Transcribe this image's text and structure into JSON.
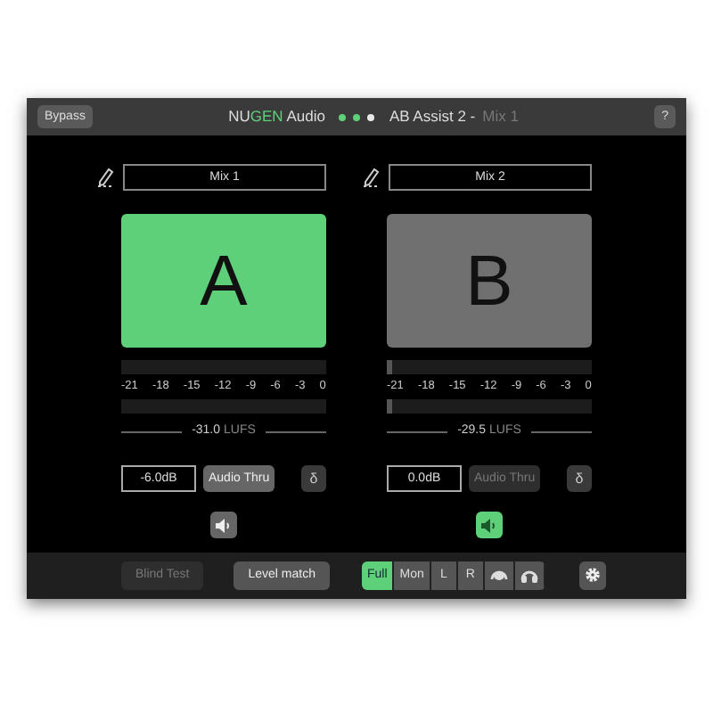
{
  "header": {
    "bypass": "Bypass",
    "brand": {
      "prefix": "NU",
      "highlight": "GEN",
      "suffix": "Audio"
    },
    "dots": [
      {
        "color": "#5fd07a"
      },
      {
        "color": "#5fd07a"
      },
      {
        "color": "#e8e8e8"
      }
    ],
    "product": "AB Assist 2 -",
    "mix": "Mix 1",
    "help": "?"
  },
  "channels": [
    {
      "label": "Mix 1",
      "letter": "A",
      "selected": true,
      "meters": [
        {
          "level": 0
        },
        {
          "level": 0
        }
      ],
      "scale": [
        "-21",
        "-18",
        "-15",
        "-12",
        "-9",
        "-6",
        "-3",
        "0"
      ],
      "lufs_value": "-31.0",
      "lufs_unit": "LUFS",
      "gain": "-6.0dB",
      "audio_thru": {
        "label": "Audio Thru",
        "on": true
      },
      "delta": "δ",
      "speaker_on": false
    },
    {
      "label": "Mix 2",
      "letter": "B",
      "selected": false,
      "meters": [
        {
          "level": 0.03
        },
        {
          "level": 0.03
        }
      ],
      "scale": [
        "-21",
        "-18",
        "-15",
        "-12",
        "-9",
        "-6",
        "-3",
        "0"
      ],
      "lufs_value": "-29.5",
      "lufs_unit": "LUFS",
      "gain": "0.0dB",
      "audio_thru": {
        "label": "Audio Thru",
        "on": false
      },
      "delta": "δ",
      "speaker_on": true
    }
  ],
  "footer": {
    "blind_test": {
      "label": "Blind Test",
      "disabled": true
    },
    "level_match": {
      "label": "Level match",
      "disabled": false
    },
    "modes": [
      {
        "kind": "text",
        "label": "Full",
        "selected": true
      },
      {
        "kind": "text",
        "label": "Mon",
        "selected": false
      },
      {
        "kind": "text",
        "label": "L",
        "selected": false
      },
      {
        "kind": "text",
        "label": "R",
        "selected": false
      },
      {
        "kind": "icon-a",
        "selected": false
      },
      {
        "kind": "icon-b",
        "selected": false
      }
    ]
  }
}
